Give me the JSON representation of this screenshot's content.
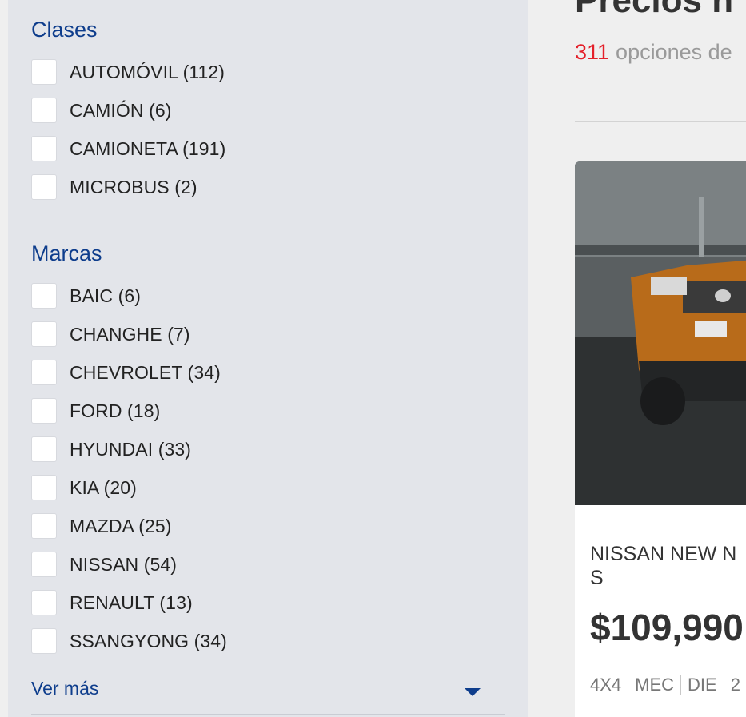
{
  "sidebar": {
    "classes_title": "Clases",
    "classes": [
      {
        "label": "AUTOMÓVIL (112)"
      },
      {
        "label": "CAMIÓN (6)"
      },
      {
        "label": "CAMIONETA (191)"
      },
      {
        "label": "MICROBUS (2)"
      }
    ],
    "brands_title": "Marcas",
    "brands": [
      {
        "label": "BAIC (6)"
      },
      {
        "label": "CHANGHE (7)"
      },
      {
        "label": "CHEVROLET (34)"
      },
      {
        "label": "FORD (18)"
      },
      {
        "label": "HYUNDAI (33)"
      },
      {
        "label": "KIA (20)"
      },
      {
        "label": "MAZDA (25)"
      },
      {
        "label": "NISSAN (54)"
      },
      {
        "label": "RENAULT (13)"
      },
      {
        "label": "SSANGYONG (34)"
      }
    ],
    "ver_mas": "Ver más"
  },
  "main": {
    "title": "Precios n",
    "results_count": "311",
    "results_text": "opciones de",
    "card": {
      "title_line1": "NISSAN NEW N",
      "title_line2": "S",
      "price": "$109,990",
      "specs": [
        "4X4",
        "MEC",
        "DIE",
        "2"
      ]
    }
  },
  "colors": {
    "accent_blue": "#0e3d8c",
    "count_red": "#e4202a",
    "sidebar_bg": "#e3e5ea"
  }
}
